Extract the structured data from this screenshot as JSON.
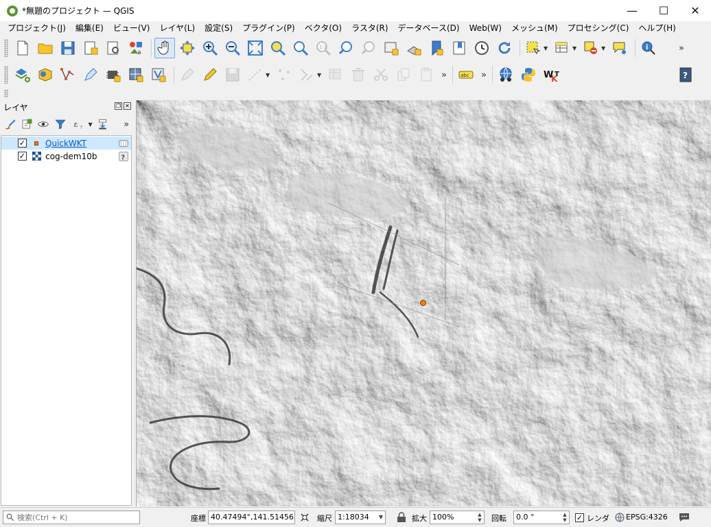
{
  "window": {
    "title": "*無題のプロジェクト — QGIS",
    "minimize": "—",
    "maximize": "☐",
    "close": "✕"
  },
  "menu": [
    "プロジェクト(J)",
    "編集(E)",
    "ビュー(V)",
    "レイヤ(L)",
    "設定(S)",
    "プラグイン(P)",
    "ベクタ(O)",
    "ラスタ(R)",
    "データベース(D)",
    "Web(W)",
    "メッシュ(M)",
    "プロセシング(C)",
    "ヘルプ(H)"
  ],
  "layer_panel": {
    "title": "レイヤ",
    "layers": [
      {
        "name": "QuickWKT",
        "checked": true,
        "selected": true,
        "type": "vector-point",
        "indicator": "edit-icon"
      },
      {
        "name": "cog-dem10b",
        "checked": true,
        "selected": false,
        "type": "raster",
        "indicator": "unknown-icon"
      }
    ]
  },
  "statusbar": {
    "locator_placeholder": "検索(Ctrl + K)",
    "coord_label": "座標",
    "coord_value": "40.47494°,141.51456°",
    "scale_label": "縮尺",
    "scale_value": "1:18034",
    "magnifier_label": "拡大",
    "magnifier_value": "100%",
    "rotation_label": "回転",
    "rotation_value": "0.0 °",
    "render_label": "レンダ",
    "render_checked": true,
    "crs": "EPSG:4326"
  },
  "colors": {
    "accent": "#589632",
    "selection": "#cde8ff",
    "marker": "#f07e18",
    "link": "#0b57c2"
  }
}
